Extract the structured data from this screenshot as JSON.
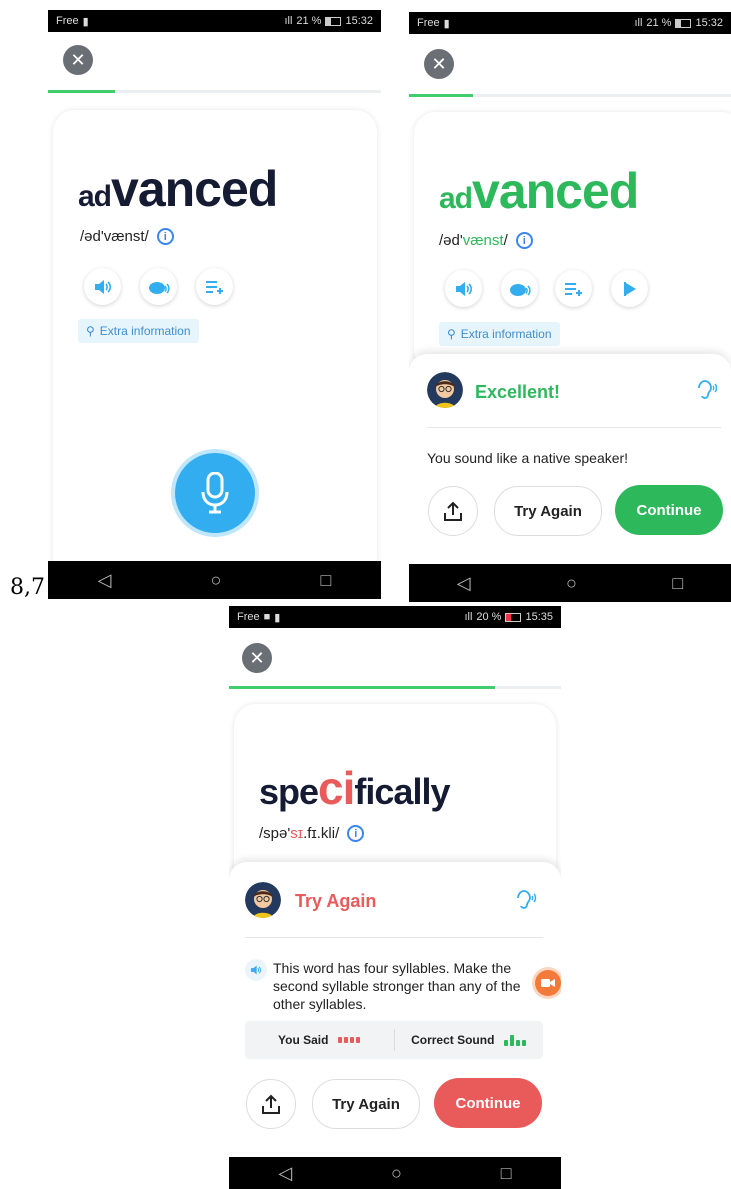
{
  "gutter_text": "8,7",
  "colors": {
    "green": "#2eb85c",
    "red": "#e95a5a",
    "blue": "#32aef0",
    "word_dark": "#141b33"
  },
  "screen1": {
    "status": {
      "carrier": "Free",
      "battery": "21 %",
      "time": "15:32"
    },
    "progress": 0.2,
    "word": {
      "prefix": "ad",
      "stress": "vanced"
    },
    "ipa": "/əd'vænst/",
    "extra_info": "Extra information",
    "icons": [
      "speaker-icon",
      "snail-icon",
      "add-to-list-icon"
    ],
    "mic_icon": "microphone-icon"
  },
  "screen2": {
    "status": {
      "carrier": "Free",
      "battery": "21 %",
      "time": "15:32"
    },
    "progress": 0.2,
    "word": {
      "prefix": "ad",
      "stress": "vanced"
    },
    "ipa": {
      "before": "/əd'",
      "mid": "vænst",
      "after": "/"
    },
    "extra_info": "Extra information",
    "icons": [
      "speaker-icon",
      "snail-icon",
      "add-to-list-icon",
      "play-flag-icon"
    ],
    "feedback": "Excellent!",
    "message": "You sound like a native speaker!",
    "try_again": "Try Again",
    "continue": "Continue"
  },
  "screen3": {
    "status": {
      "carrier": "Free",
      "battery": "20 %",
      "time": "15:35"
    },
    "progress": 0.8,
    "word": {
      "before": "spe",
      "stress": "ci",
      "after": "fically"
    },
    "ipa": {
      "before": "/spə'",
      "mid": "sɪ",
      "after": ".fɪ.kli/"
    },
    "feedback": "Try Again",
    "hint": "This word has four syllables. Make the second syllable stronger than any of the other syllables.",
    "you_said": "You Said",
    "correct_sound": "Correct Sound",
    "try_again": "Try Again",
    "continue": "Continue"
  }
}
